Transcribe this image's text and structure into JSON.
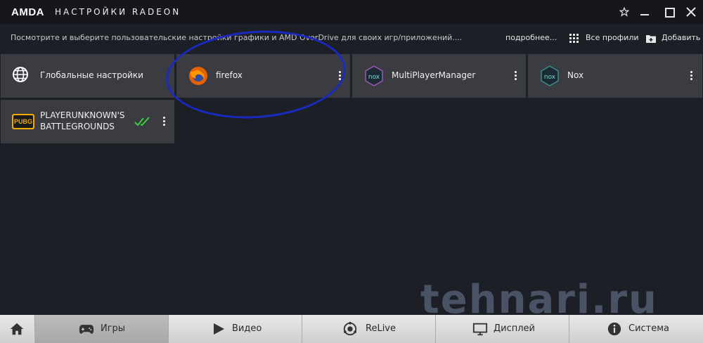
{
  "header": {
    "logo": "AMDA",
    "title": "НАСТРОЙКИ RADEON"
  },
  "subheader": {
    "hint": "Посмотрите и выберите пользовательские настройки графики и AMD OverDrive для своих игр/приложений....",
    "more_link": "подробнее...",
    "all_profiles": "Все профили",
    "add": "Добавить"
  },
  "tiles": [
    {
      "label": "Глобальные настройки"
    },
    {
      "label": "firefox"
    },
    {
      "label": "MultiPlayerManager"
    },
    {
      "label": "Nox"
    },
    {
      "label_line1": "PLAYERUNKNOWN'S",
      "label_line2": "BATTLEGROUNDS",
      "badge": "PUBG"
    }
  ],
  "nav": {
    "games": "Игры",
    "video": "Видео",
    "relive": "ReLive",
    "display": "Дисплей",
    "system": "Система"
  },
  "watermark": "tehnari.ru",
  "colors": {
    "background": "#1c1f26",
    "tile": "#3a3c42",
    "check_green": "#3ccf3c",
    "annotation_blue": "#1a2ac0"
  }
}
